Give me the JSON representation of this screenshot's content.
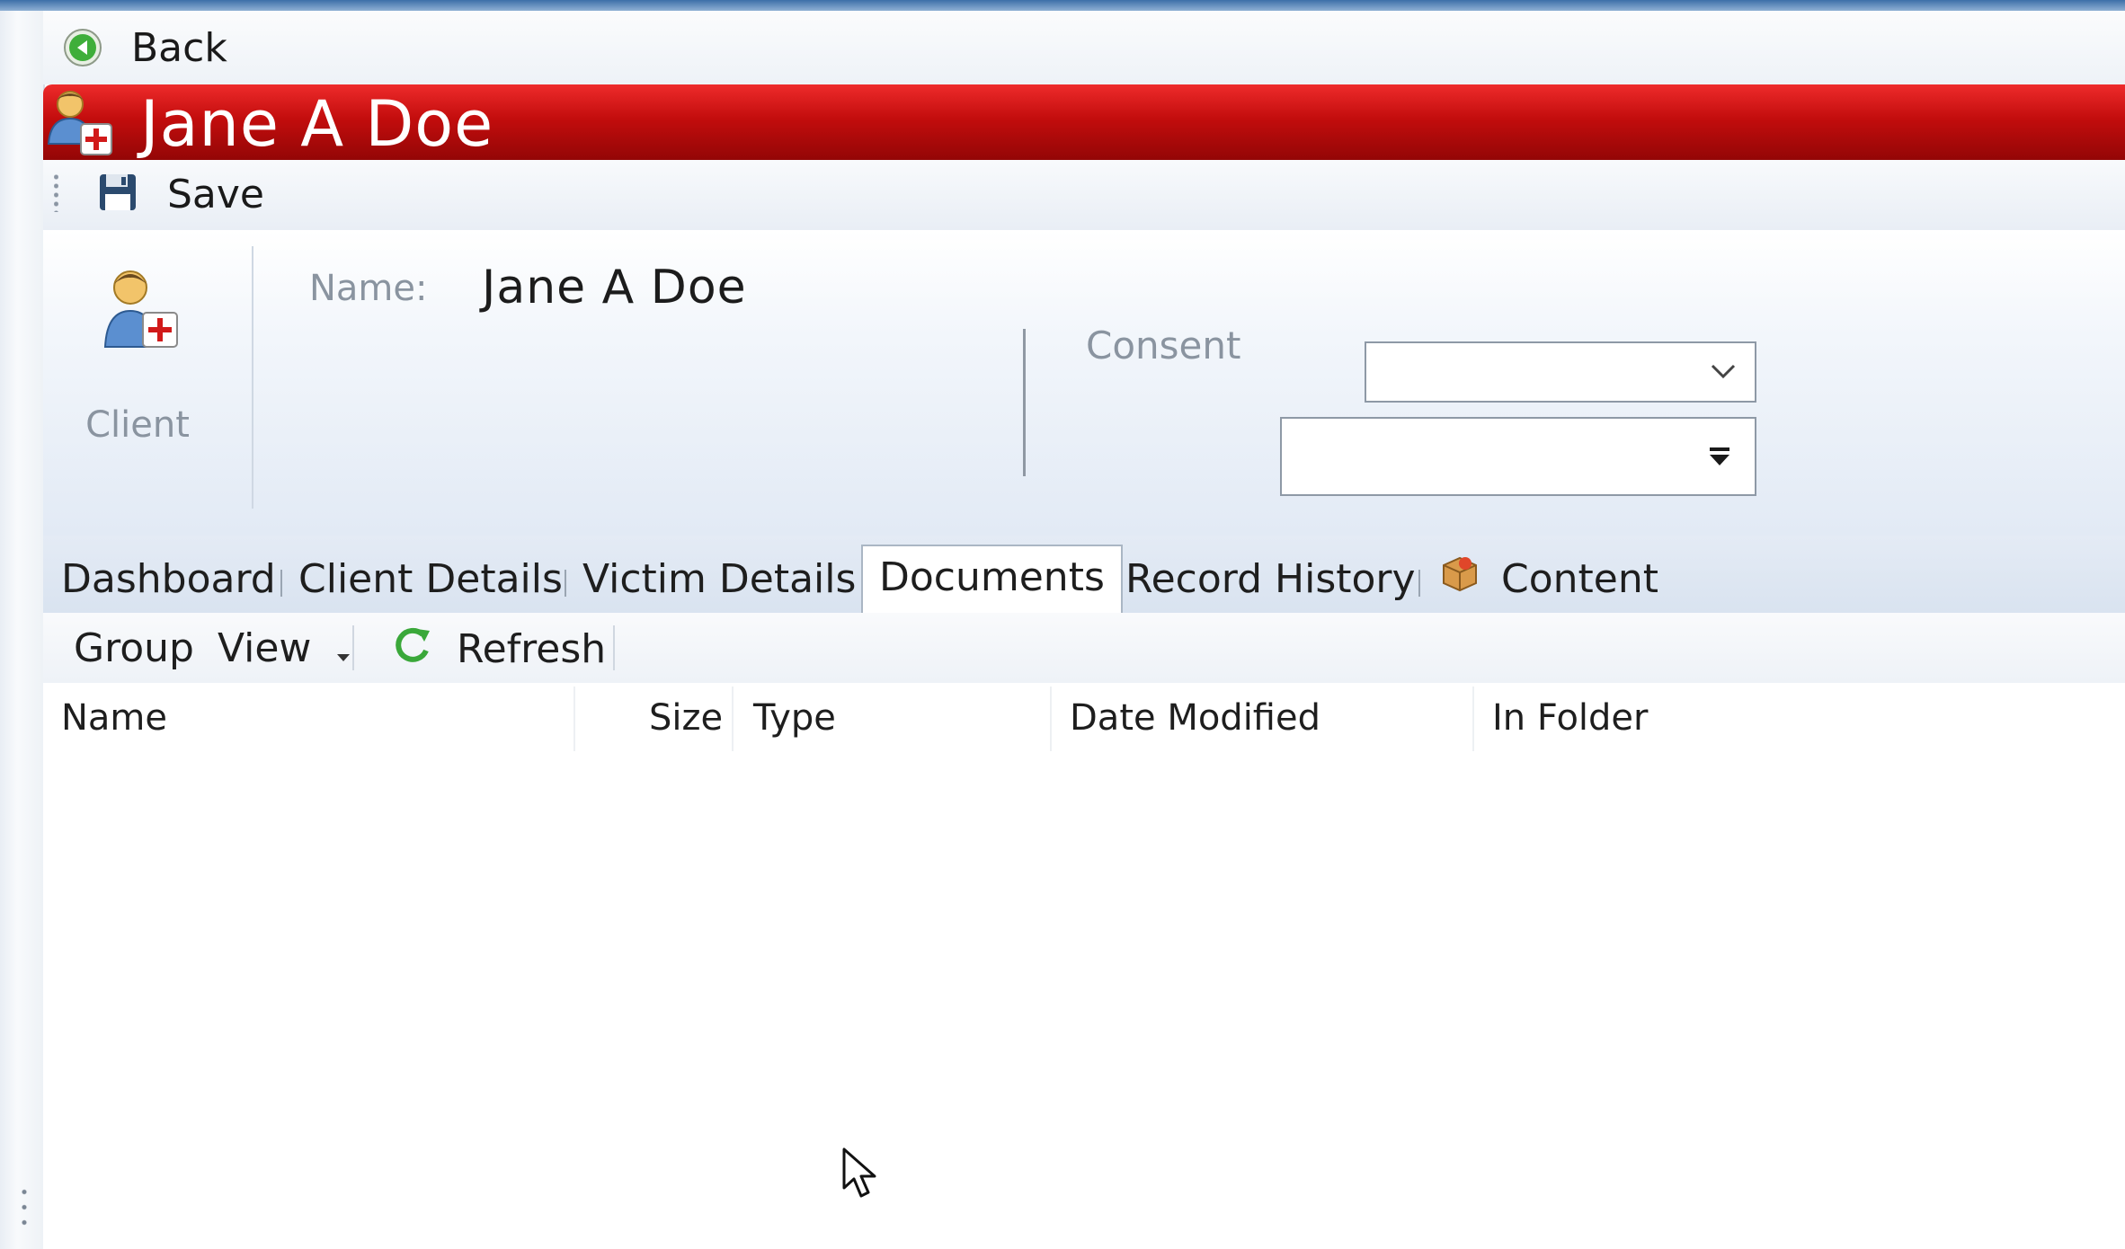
{
  "nav": {
    "back_label": "Back",
    "back_icon": "back-arrow-icon"
  },
  "title_bar": {
    "title": "Jane A Doe",
    "icon": "client-icon",
    "accent": "#c40d0d"
  },
  "toolbar": {
    "save_label": "Save",
    "save_icon": "floppy-disk-icon"
  },
  "header": {
    "client_label": "Client",
    "name_label": "Name:",
    "name_value": "Jane A Doe",
    "consent_label": "Consent",
    "consent_value": "",
    "second_value": ""
  },
  "tabs": [
    {
      "label": "Dashboard",
      "active": false
    },
    {
      "label": "Client Details",
      "active": false
    },
    {
      "label": "Victim Details",
      "active": false
    },
    {
      "label": "Documents",
      "active": true
    },
    {
      "label": "Record History",
      "active": false
    },
    {
      "label": "Content",
      "active": false,
      "icon": "package-icon"
    }
  ],
  "doc_toolbar": {
    "group_label": "Group",
    "view_label": "View",
    "refresh_label": "Refresh"
  },
  "grid": {
    "columns": [
      "Name",
      "Size",
      "Type",
      "Date Modified",
      "In Folder"
    ],
    "rows": []
  }
}
